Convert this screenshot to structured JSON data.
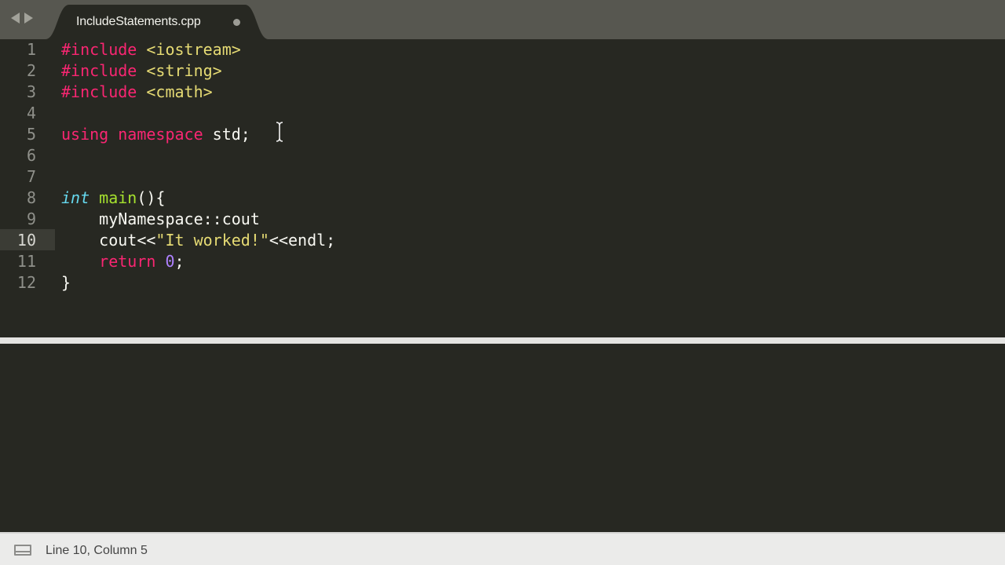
{
  "tab": {
    "title": "IncludeStatements.cpp",
    "dirty_indicator": "●"
  },
  "editor": {
    "active_line": 10,
    "lines": [
      {
        "number": "1",
        "tokens": [
          {
            "t": "#include",
            "c": "kw"
          },
          {
            "t": " ",
            "c": "plain"
          },
          {
            "t": "<iostream>",
            "c": "str"
          }
        ]
      },
      {
        "number": "2",
        "tokens": [
          {
            "t": "#include",
            "c": "kw"
          },
          {
            "t": " ",
            "c": "plain"
          },
          {
            "t": "<string>",
            "c": "str"
          }
        ]
      },
      {
        "number": "3",
        "tokens": [
          {
            "t": "#include",
            "c": "kw"
          },
          {
            "t": " ",
            "c": "plain"
          },
          {
            "t": "<cmath>",
            "c": "str"
          }
        ]
      },
      {
        "number": "4",
        "tokens": []
      },
      {
        "number": "5",
        "tokens": [
          {
            "t": "using",
            "c": "kw"
          },
          {
            "t": " ",
            "c": "plain"
          },
          {
            "t": "namespace",
            "c": "kw"
          },
          {
            "t": " std;",
            "c": "plain"
          }
        ]
      },
      {
        "number": "6",
        "tokens": []
      },
      {
        "number": "7",
        "tokens": []
      },
      {
        "number": "8",
        "tokens": [
          {
            "t": "int",
            "c": "type"
          },
          {
            "t": " ",
            "c": "plain"
          },
          {
            "t": "main",
            "c": "fn"
          },
          {
            "t": "(){",
            "c": "plain"
          }
        ]
      },
      {
        "number": "9",
        "tokens": [
          {
            "t": "    myNamespace::cout",
            "c": "plain"
          }
        ]
      },
      {
        "number": "10",
        "tokens": [
          {
            "t": "    cout<<",
            "c": "plain"
          },
          {
            "t": "\"It worked!\"",
            "c": "str"
          },
          {
            "t": "<<endl;",
            "c": "plain"
          }
        ]
      },
      {
        "number": "11",
        "tokens": [
          {
            "t": "    ",
            "c": "plain"
          },
          {
            "t": "return",
            "c": "kw"
          },
          {
            "t": " ",
            "c": "plain"
          },
          {
            "t": "0",
            "c": "num"
          },
          {
            "t": ";",
            "c": "plain"
          }
        ]
      },
      {
        "number": "12",
        "tokens": [
          {
            "t": "}",
            "c": "plain"
          }
        ]
      }
    ]
  },
  "colors": {
    "keyword": "#f92672",
    "string": "#e6db74",
    "type": "#66d9ef",
    "function": "#a6e22e",
    "number": "#ae81ff",
    "text": "#f8f8f2",
    "background": "#272822"
  },
  "statusbar": {
    "position_text": "Line 10, Column 5",
    "panel_icon": "panel-toggle-icon"
  },
  "icons": {
    "back": "back-arrow-icon",
    "forward": "forward-arrow-icon",
    "cursor": "text-cursor-icon"
  }
}
